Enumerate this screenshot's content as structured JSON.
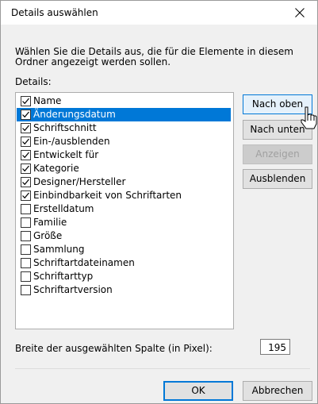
{
  "window": {
    "title": "Details auswählen",
    "close_glyph": "close-icon"
  },
  "description": "Wählen Sie die Details aus, die für die Elemente in diesem Ordner angezeigt werden sollen.",
  "details_label": "Details:",
  "details": [
    {
      "label": "Name",
      "checked": true,
      "selected": false
    },
    {
      "label": "Änderungsdatum",
      "checked": true,
      "selected": true
    },
    {
      "label": "Schriftschnitt",
      "checked": true,
      "selected": false
    },
    {
      "label": "Ein-/ausblenden",
      "checked": true,
      "selected": false
    },
    {
      "label": "Entwickelt für",
      "checked": true,
      "selected": false
    },
    {
      "label": "Kategorie",
      "checked": true,
      "selected": false
    },
    {
      "label": "Designer/Hersteller",
      "checked": true,
      "selected": false
    },
    {
      "label": "Einbindbarkeit von Schriftarten",
      "checked": true,
      "selected": false
    },
    {
      "label": "Erstelldatum",
      "checked": false,
      "selected": false
    },
    {
      "label": "Familie",
      "checked": false,
      "selected": false
    },
    {
      "label": "Größe",
      "checked": false,
      "selected": false
    },
    {
      "label": "Sammlung",
      "checked": false,
      "selected": false
    },
    {
      "label": "Schriftartdateinamen",
      "checked": false,
      "selected": false
    },
    {
      "label": "Schriftarttyp",
      "checked": false,
      "selected": false
    },
    {
      "label": "Schriftartversion",
      "checked": false,
      "selected": false
    }
  ],
  "buttons": {
    "move_up": "Nach oben",
    "move_down": "Nach unten",
    "show": "Anzeigen",
    "hide": "Ausblenden",
    "ok": "OK",
    "cancel": "Abbrechen"
  },
  "column_width": {
    "label": "Breite der ausgewählten Spalte (in Pixel):",
    "value": "195"
  },
  "colors": {
    "selection": "#0078d7",
    "dialog_bg": "#f0f0f0"
  }
}
